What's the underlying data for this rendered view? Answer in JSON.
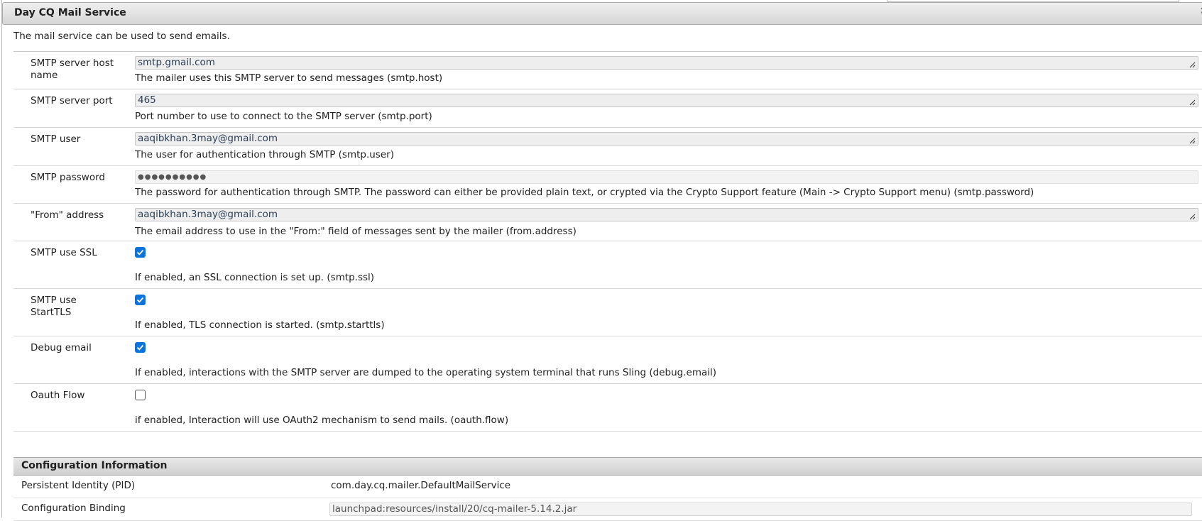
{
  "dialog": {
    "title": "Day CQ Mail Service",
    "close_glyph": "×",
    "description": "The mail service can be used to send emails."
  },
  "fields": {
    "smtp_host": {
      "label": "SMTP server host name",
      "value": "smtp.gmail.com",
      "help": "The mailer uses this SMTP server to send messages (smtp.host)"
    },
    "smtp_port": {
      "label": "SMTP server port",
      "value": "465",
      "help": "Port number to use to connect to the SMTP server (smtp.port)"
    },
    "smtp_user": {
      "label": "SMTP user",
      "value": "aaqibkhan.3may@gmail.com",
      "help": "The user for authentication through SMTP (smtp.user)"
    },
    "smtp_password": {
      "label": "SMTP password",
      "value": "●●●●●●●●●●",
      "help": "The password for authentication through SMTP. The password can either be provided plain text, or crypted via the Crypto Support feature (Main -> Crypto Support menu) (smtp.password)"
    },
    "from_address": {
      "label": "\"From\" address",
      "value": "aaqibkhan.3may@gmail.com",
      "help": "The email address to use in the \"From:\" field of messages sent by the mailer (from.address)"
    },
    "smtp_ssl": {
      "label": "SMTP use SSL",
      "checked": true,
      "help": "If enabled, an SSL connection is set up. (smtp.ssl)"
    },
    "smtp_starttls": {
      "label": "SMTP use StartTLS",
      "checked": true,
      "help": "If enabled, TLS connection is started. (smtp.starttls)"
    },
    "debug_email": {
      "label": "Debug email",
      "checked": true,
      "help": "If enabled, interactions with the SMTP server are dumped to the operating system terminal that runs Sling (debug.email)"
    },
    "oauth_flow": {
      "label": "Oauth Flow",
      "checked": false,
      "help": "if enabled, Interaction will use OAuth2 mechanism to send mails. (oauth.flow)"
    }
  },
  "config_info": {
    "heading": "Configuration Information",
    "pid_label": "Persistent Identity (PID)",
    "pid_value": "com.day.cq.mailer.DefaultMailService",
    "binding_label": "Configuration Binding",
    "binding_value": "launchpad:resources/install/20/cq-mailer-5.14.2.jar"
  },
  "colors": {
    "checkbox_checked": "#0b74da",
    "title_bar": "#d6d6d6"
  }
}
